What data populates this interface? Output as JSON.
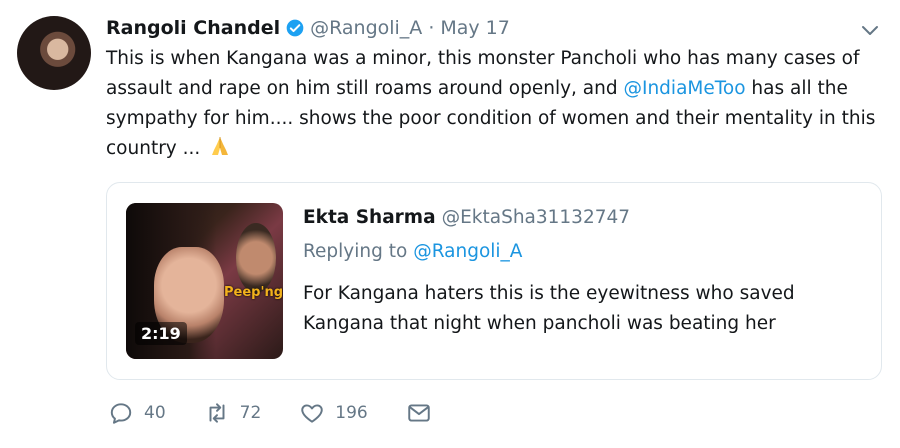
{
  "tweet": {
    "author_name": "Rangoli Chandel",
    "handle": "@Rangoli_A",
    "separator": "·",
    "date": "May 17",
    "text_part1": "This is when Kangana was a minor, this monster Pancholi who has many cases of assault and rape on him still roams around openly, and ",
    "mention": "@IndiaMeToo",
    "text_part2": " has all the sympathy for him.... shows the poor condition of women and their mentality in this country ... "
  },
  "quote": {
    "author_name": "Ekta Sharma",
    "handle": "@EktaSha31132747",
    "replying_prefix": "Replying to ",
    "replying_to": "@Rangoli_A",
    "text": "For Kangana haters this is the eyewitness who saved Kangana that night when pancholi was beating her",
    "video_duration": "2:19",
    "thumb_logo": "Peep'ng"
  },
  "actions": {
    "replies": "40",
    "retweets": "72",
    "likes": "196"
  },
  "colors": {
    "link": "#1b95e0",
    "muted": "#657786",
    "verified": "#1da1f2"
  }
}
